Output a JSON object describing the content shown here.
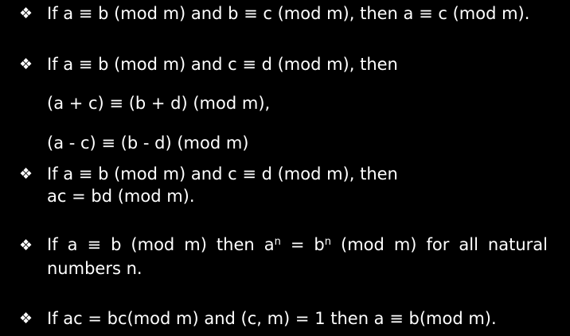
{
  "bullet_glyph": "❖",
  "items": [
    {
      "lines": [
        "If a ≡ b (mod m) and b ≡ c (mod m), then a ≡ c (mod m)."
      ]
    },
    {
      "lines": [
        "If a ≡ b (mod m) and c ≡ d (mod m), then",
        "(a + c) ≡ (b + d) (mod m),",
        "(a - c) ≡ (b - d) (mod m)"
      ]
    },
    {
      "lines": [
        "If a ≡ b (mod m) and c ≡ d (mod m), then",
        "ac = bd (mod m)."
      ]
    },
    {
      "words": [
        "If",
        "a",
        "≡",
        "b",
        "(mod",
        "m)",
        "then",
        "a",
        "=",
        "b",
        "(mod",
        "m)",
        "for",
        "all",
        "natural"
      ],
      "exponent": "n",
      "continuation": "numbers n."
    },
    {
      "lines": [
        "If ac = bc(mod m) and (c, m) = 1 then a ≡ b(mod m)."
      ]
    }
  ]
}
